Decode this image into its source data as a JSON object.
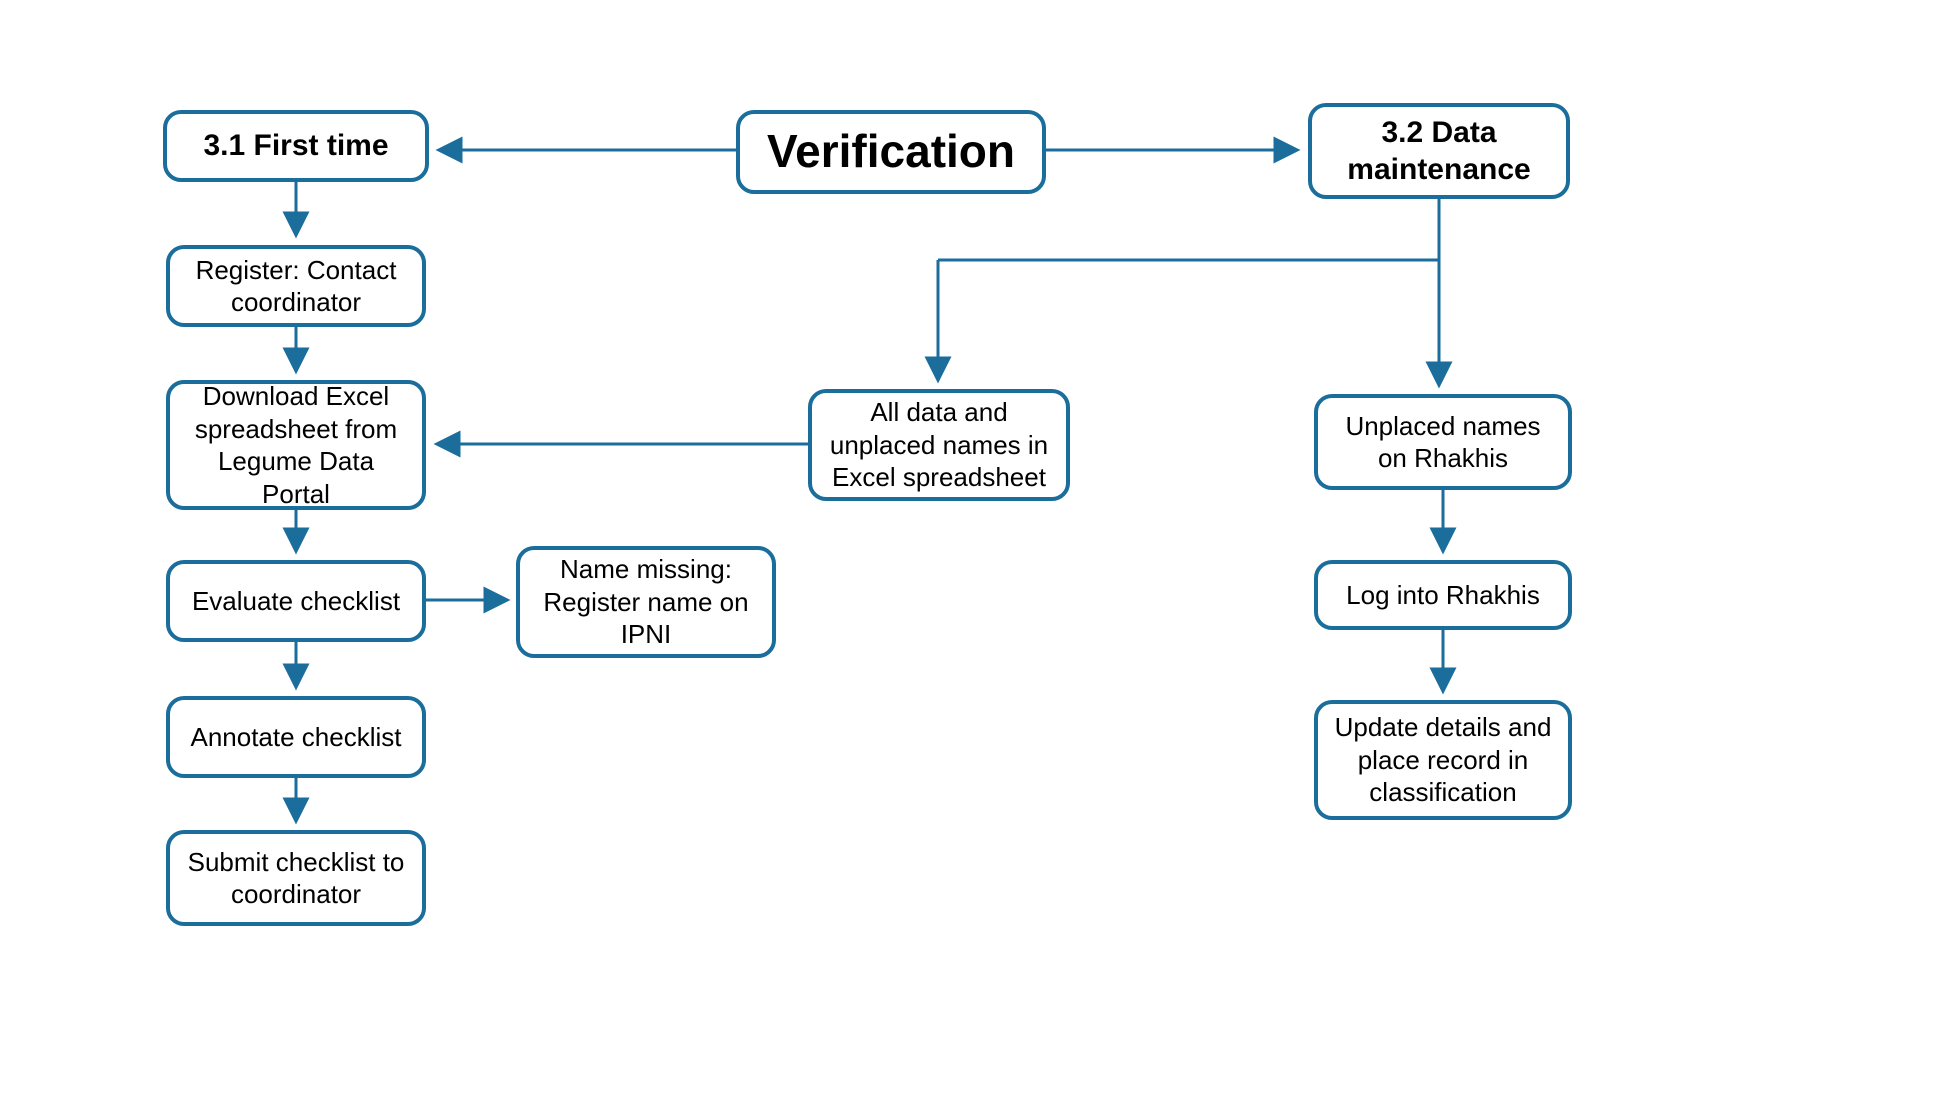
{
  "colors": {
    "stroke": "#1b6e9c"
  },
  "nodes": {
    "verification": "Verification",
    "first_time": "3.1 First time",
    "data_maintenance": "3.2 Data maintenance",
    "register_contact": "Register: Contact coordinator",
    "download_excel": "Download Excel spreadsheet from Legume Data Portal",
    "evaluate_checklist": "Evaluate checklist",
    "name_missing": "Name missing: Register name on IPNI",
    "annotate_checklist": "Annotate checklist",
    "submit_checklist": "Submit checklist to coordinator",
    "all_data_unplaced": "All data and unplaced names in Excel spreadsheet",
    "unplaced_rhakhis": "Unplaced names on Rhakhis",
    "log_into_rhakhis": "Log into Rhakhis",
    "update_details": "Update details and place record in classification"
  }
}
